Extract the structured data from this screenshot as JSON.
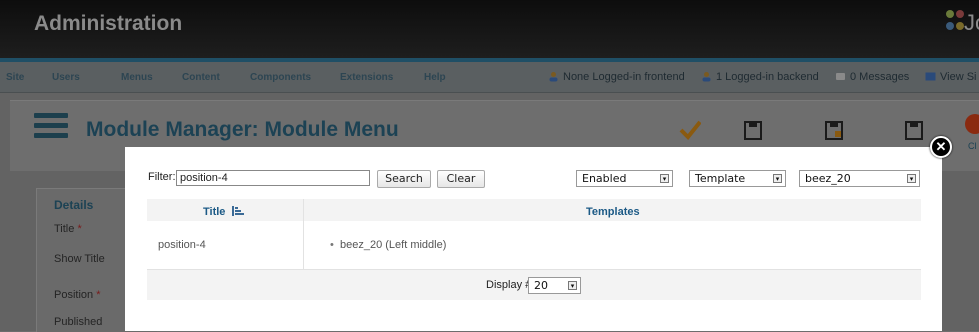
{
  "header": {
    "title": "Administration",
    "brand_text": "Jo"
  },
  "menu": {
    "items": [
      "Site",
      "Users",
      "Menus",
      "Content",
      "Components",
      "Extensions",
      "Help"
    ],
    "status": {
      "frontend": "None Logged-in frontend",
      "backend": "1 Logged-in backend",
      "messages": "0 Messages",
      "view_site": "View Si"
    }
  },
  "page": {
    "title": "Module Manager: Module Menu",
    "close_toolbar_label": "Cl"
  },
  "details": {
    "legend": "Details",
    "fields": [
      "Title",
      "Show Title",
      "Position",
      "Published"
    ]
  },
  "modal": {
    "filter_label": "Filter:",
    "filter_value": "position-4",
    "search_label": "Search",
    "clear_label": "Clear",
    "state_select": "Enabled",
    "type_select": "Template",
    "template_select": "beez_20",
    "columns": {
      "title": "Title",
      "templates": "Templates"
    },
    "rows": [
      {
        "title": "position-4",
        "template": "beez_20 (Left middle)"
      }
    ],
    "display_label": "Display #",
    "display_value": "20"
  },
  "colors": {
    "accent": "#1c5a86",
    "brand": "#1c4254",
    "required": "#7a1b1b"
  }
}
